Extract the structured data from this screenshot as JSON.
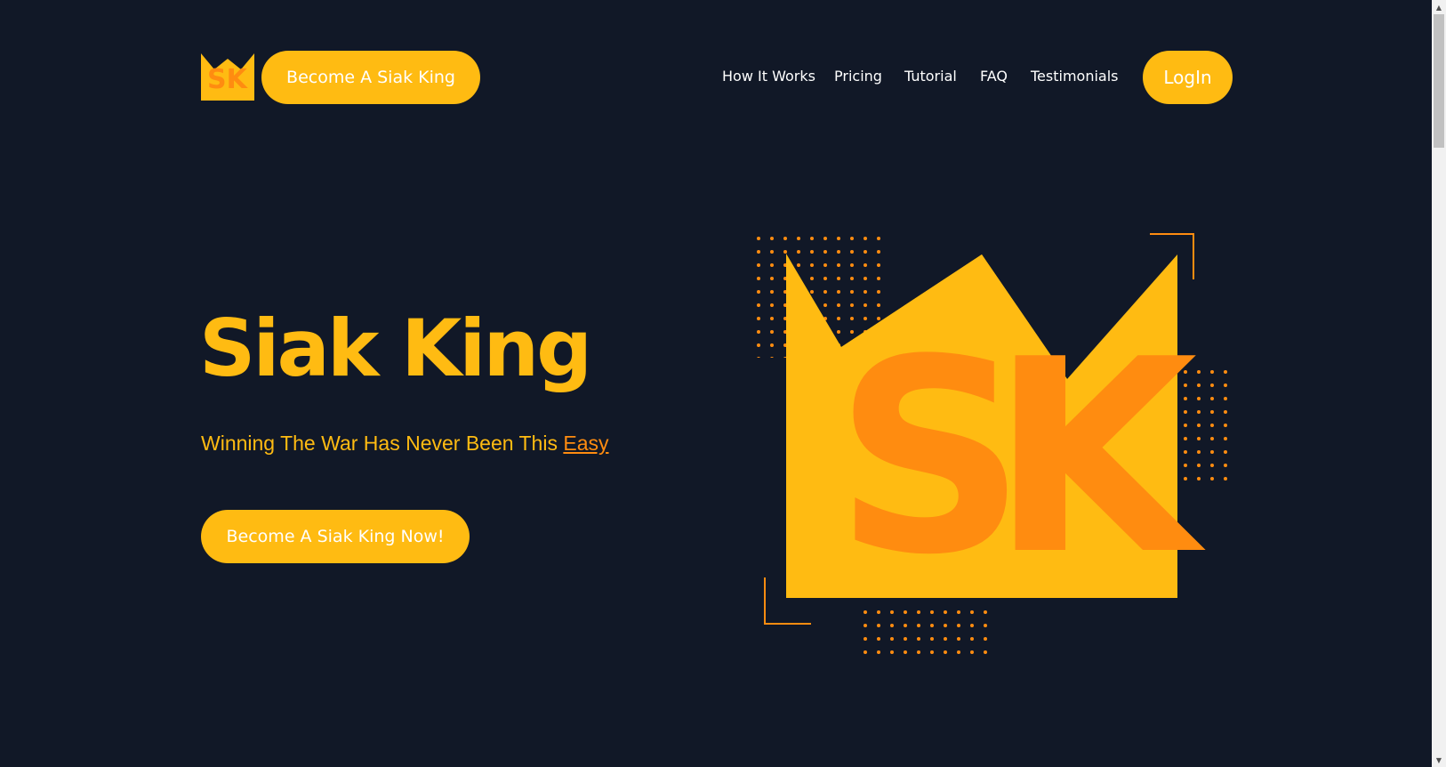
{
  "header": {
    "logo_text": "SK",
    "become_label": "Become A Siak King",
    "nav": [
      "How It Works",
      "Pricing",
      "Tutorial",
      "FAQ",
      "Testimonials"
    ],
    "login_label": "LogIn"
  },
  "hero": {
    "title": "Siak King",
    "subtitle_prefix": "Winning The War Has Never Been This ",
    "subtitle_link": "Easy",
    "cta_label": "Become A Siak King Now!",
    "art_text": "SK"
  },
  "colors": {
    "background": "#111827",
    "accent": "#ffbb12",
    "accent_dark": "#ff8c10",
    "text": "#ffffff"
  },
  "icons": {
    "logo": "crown-sk-logo",
    "scroll_up": "triangle-up-icon",
    "scroll_down": "triangle-down-icon"
  }
}
